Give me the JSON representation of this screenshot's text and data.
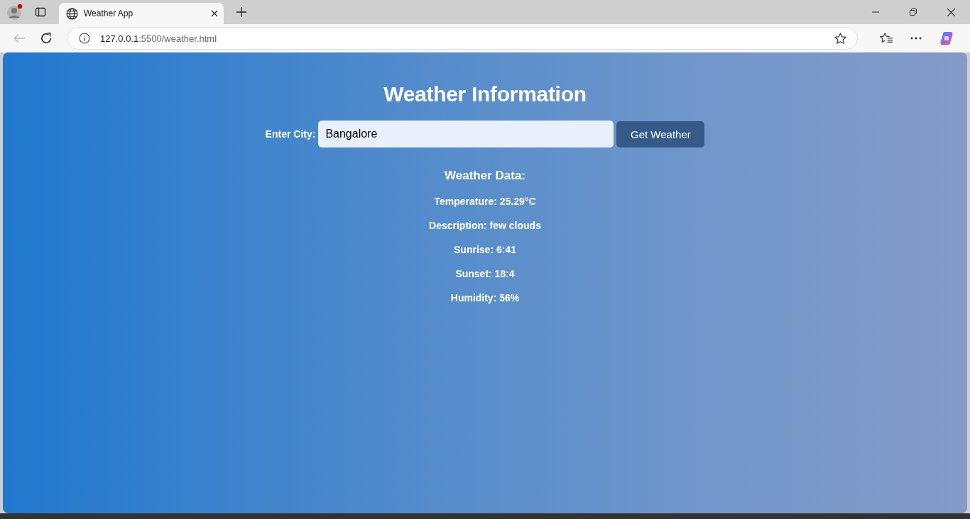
{
  "browser": {
    "tab": {
      "title": "Weather App",
      "selected": true
    },
    "address": {
      "host": "127.0.0.1",
      "path": ":5500/weather.html"
    }
  },
  "page": {
    "heading": "Weather Information",
    "city_label": "Enter City:",
    "city_input": {
      "value": "Bangalore"
    },
    "button": "Get Weather",
    "data_heading": "Weather Data:",
    "readings": [
      "Temperature: 25.29°C",
      "Description: few clouds",
      "Sunrise: 6:41",
      "Sunset: 18:4",
      "Humidity: 56%"
    ]
  }
}
